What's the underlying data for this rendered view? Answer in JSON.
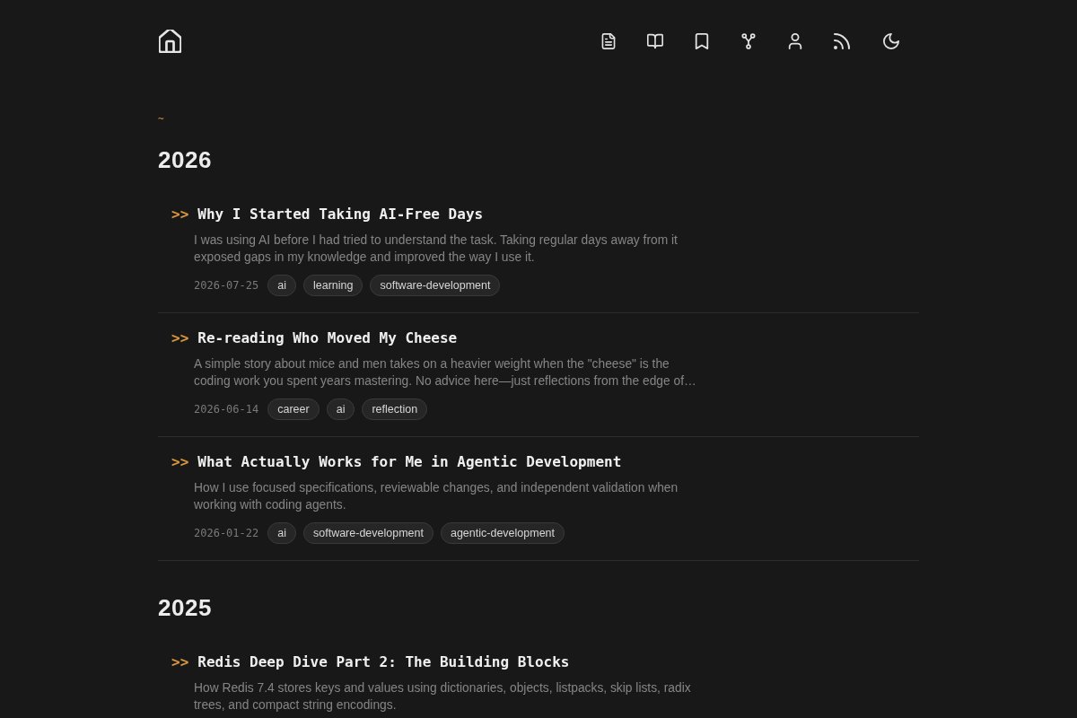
{
  "breadcrumb": "~",
  "sections": [
    {
      "year": "2026",
      "posts": [
        {
          "marker": ">>",
          "title": "Why I Started Taking AI-Free Days",
          "summary": "I was using AI before I had tried to understand the task. Taking regular days away from it exposed gaps in my knowledge and improved the way I use it.",
          "date": "2026-07-25",
          "tags": [
            "ai",
            "learning",
            "software-development"
          ]
        },
        {
          "marker": ">>",
          "title": "Re-reading Who Moved My Cheese",
          "summary": "A simple story about mice and men takes on a heavier weight when the \"cheese\" is the coding work you spent years mastering. No advice here—just reflections from the edge of…",
          "date": "2026-06-14",
          "tags": [
            "career",
            "ai",
            "reflection"
          ]
        },
        {
          "marker": ">>",
          "title": "What Actually Works for Me in Agentic Development",
          "summary": "How I use focused specifications, reviewable changes, and independent validation when working with coding agents.",
          "date": "2026-01-22",
          "tags": [
            "ai",
            "software-development",
            "agentic-development"
          ]
        }
      ]
    },
    {
      "year": "2025",
      "posts": [
        {
          "marker": ">>",
          "title": "Redis Deep Dive Part 2: The Building Blocks",
          "summary": "How Redis 7.4 stores keys and values using dictionaries, objects, listpacks, skip lists, radix trees, and compact string encodings."
        }
      ]
    }
  ]
}
